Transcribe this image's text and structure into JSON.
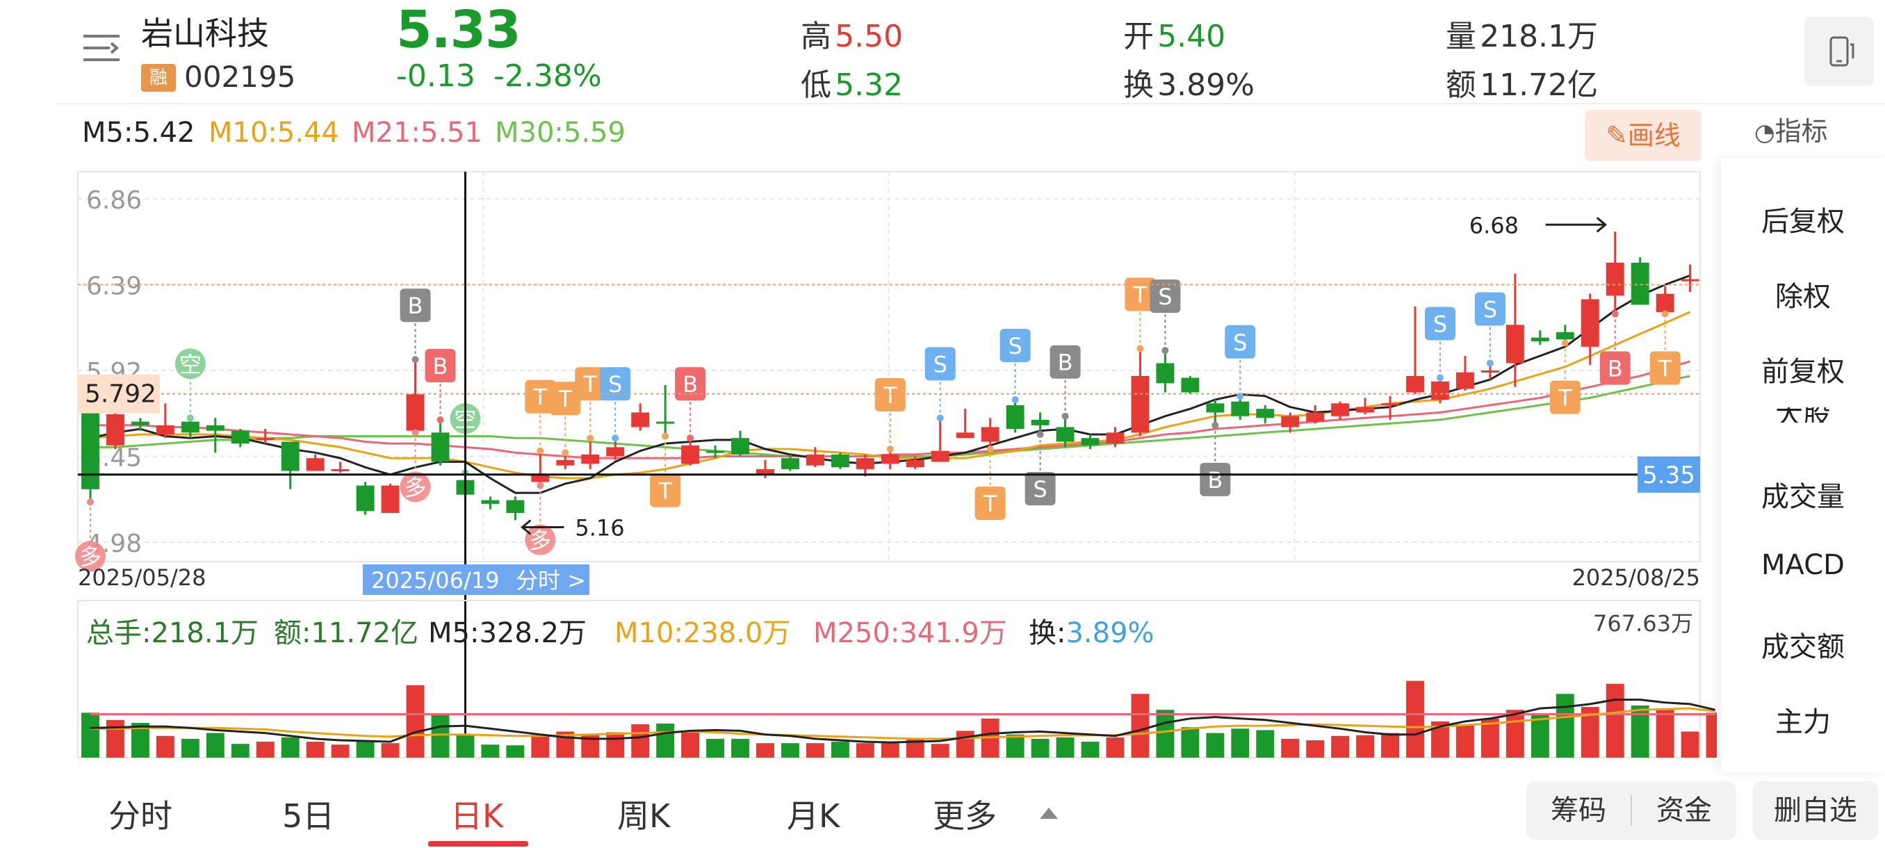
{
  "header": {
    "name": "岩山科技",
    "badge": "融",
    "code": "002195",
    "price": "5.33",
    "change": "-0.13",
    "change_pct": "-2.38%",
    "high_label": "高",
    "high": "5.50",
    "low_label": "低",
    "low": "5.32",
    "open_label": "开",
    "open": "5.40",
    "turnover_label": "换",
    "turnover": "3.89%",
    "volume_label": "量",
    "volume": "218.1万",
    "amount_label": "额",
    "amount": "11.72亿"
  },
  "ma": {
    "m5": "M5:5.42",
    "m10": "M10:5.44",
    "m21": "M21:5.51",
    "m30": "M30:5.59",
    "colors": {
      "m5": "#222222",
      "m10": "#e8a317",
      "m21": "#e86877",
      "m30": "#6cc24a"
    }
  },
  "draw_button": "画线",
  "indicator_button": "指标",
  "right_panel": {
    "items": [
      "后复权",
      "除权",
      "前复权",
      "成交量",
      "MACD",
      "成交额",
      "主力"
    ],
    "partial": "大股"
  },
  "chart_data": {
    "type": "candlestick",
    "y_ticks": [
      "6.86",
      "6.39",
      "5.92",
      "5.45",
      "4.98"
    ],
    "ylim": [
      4.98,
      6.86
    ],
    "crosshair_value": "5.792",
    "current_price_tag": "5.35",
    "start_date": "2025/05/28",
    "cursor_date": "2025/06/19",
    "cursor_link": "分时 >",
    "end_date": "2025/08/25",
    "max_label": "6.68",
    "min_label": "5.16",
    "candles": [
      {
        "o": 5.69,
        "c": 5.27,
        "h": 5.74,
        "l": 5.2
      },
      {
        "o": 5.51,
        "c": 5.68,
        "h": 5.72,
        "l": 5.49
      },
      {
        "o": 5.64,
        "c": 5.62,
        "h": 5.66,
        "l": 5.59
      },
      {
        "o": 5.57,
        "c": 5.62,
        "h": 5.74,
        "l": 5.55
      },
      {
        "o": 5.64,
        "c": 5.58,
        "h": 5.66,
        "l": 5.55
      },
      {
        "o": 5.62,
        "c": 5.59,
        "h": 5.66,
        "l": 5.47
      },
      {
        "o": 5.59,
        "c": 5.52,
        "h": 5.6,
        "l": 5.5
      },
      {
        "o": 5.55,
        "c": 5.55,
        "h": 5.6,
        "l": 5.52
      },
      {
        "o": 5.53,
        "c": 5.37,
        "h": 5.53,
        "l": 5.27
      },
      {
        "o": 5.37,
        "c": 5.44,
        "h": 5.46,
        "l": 5.37
      },
      {
        "o": 5.38,
        "c": 5.38,
        "h": 5.42,
        "l": 5.36
      },
      {
        "o": 5.29,
        "c": 5.15,
        "h": 5.31,
        "l": 5.13
      },
      {
        "o": 5.14,
        "c": 5.29,
        "h": 5.3,
        "l": 5.14
      },
      {
        "o": 5.59,
        "c": 5.79,
        "h": 5.98,
        "l": 5.58
      },
      {
        "o": 5.58,
        "c": 5.42,
        "h": 5.65,
        "l": 5.4
      },
      {
        "o": 5.32,
        "c": 5.24,
        "h": 5.36,
        "l": 5.18
      },
      {
        "o": 5.21,
        "c": 5.19,
        "h": 5.23,
        "l": 5.16
      },
      {
        "o": 5.21,
        "c": 5.14,
        "h": 5.23,
        "l": 5.1
      },
      {
        "o": 5.31,
        "c": 5.35,
        "h": 5.48,
        "l": 5.29
      },
      {
        "o": 5.4,
        "c": 5.43,
        "h": 5.47,
        "l": 5.38
      },
      {
        "o": 5.41,
        "c": 5.46,
        "h": 5.55,
        "l": 5.38
      },
      {
        "o": 5.45,
        "c": 5.5,
        "h": 5.55,
        "l": 5.43
      },
      {
        "o": 5.61,
        "c": 5.69,
        "h": 5.74,
        "l": 5.59
      },
      {
        "o": 5.64,
        "c": 5.63,
        "h": 5.84,
        "l": 5.56
      },
      {
        "o": 5.41,
        "c": 5.51,
        "h": 5.55,
        "l": 5.4
      },
      {
        "o": 5.48,
        "c": 5.47,
        "h": 5.51,
        "l": 5.44
      },
      {
        "o": 5.55,
        "c": 5.46,
        "h": 5.59,
        "l": 5.45
      },
      {
        "o": 5.35,
        "c": 5.38,
        "h": 5.43,
        "l": 5.33
      },
      {
        "o": 5.44,
        "c": 5.38,
        "h": 5.46,
        "l": 5.37
      },
      {
        "o": 5.4,
        "c": 5.46,
        "h": 5.5,
        "l": 5.39
      },
      {
        "o": 5.46,
        "c": 5.39,
        "h": 5.47,
        "l": 5.38
      },
      {
        "o": 5.38,
        "c": 5.44,
        "h": 5.46,
        "l": 5.34
      },
      {
        "o": 5.41,
        "c": 5.46,
        "h": 5.49,
        "l": 5.38
      },
      {
        "o": 5.39,
        "c": 5.43,
        "h": 5.45,
        "l": 5.38
      },
      {
        "o": 5.42,
        "c": 5.48,
        "h": 5.66,
        "l": 5.42
      },
      {
        "o": 5.55,
        "c": 5.58,
        "h": 5.71,
        "l": 5.55
      },
      {
        "o": 5.53,
        "c": 5.61,
        "h": 5.66,
        "l": 5.49
      },
      {
        "o": 5.73,
        "c": 5.6,
        "h": 5.76,
        "l": 5.58
      },
      {
        "o": 5.65,
        "c": 5.62,
        "h": 5.69,
        "l": 5.57
      },
      {
        "o": 5.61,
        "c": 5.53,
        "h": 5.67,
        "l": 5.5
      },
      {
        "o": 5.55,
        "c": 5.51,
        "h": 5.57,
        "l": 5.49
      },
      {
        "o": 5.52,
        "c": 5.58,
        "h": 5.61,
        "l": 5.5
      },
      {
        "o": 5.58,
        "c": 5.89,
        "h": 6.04,
        "l": 5.56
      },
      {
        "o": 5.96,
        "c": 5.85,
        "h": 6.03,
        "l": 5.8
      },
      {
        "o": 5.88,
        "c": 5.8,
        "h": 5.89,
        "l": 5.79
      },
      {
        "o": 5.74,
        "c": 5.69,
        "h": 5.76,
        "l": 5.62
      },
      {
        "o": 5.75,
        "c": 5.67,
        "h": 5.78,
        "l": 5.65
      },
      {
        "o": 5.71,
        "c": 5.66,
        "h": 5.73,
        "l": 5.63
      },
      {
        "o": 5.61,
        "c": 5.67,
        "h": 5.69,
        "l": 5.58
      },
      {
        "o": 5.64,
        "c": 5.69,
        "h": 5.73,
        "l": 5.63
      },
      {
        "o": 5.67,
        "c": 5.74,
        "h": 5.75,
        "l": 5.65
      },
      {
        "o": 5.69,
        "c": 5.72,
        "h": 5.77,
        "l": 5.68
      },
      {
        "o": 5.74,
        "c": 5.74,
        "h": 5.78,
        "l": 5.65
      },
      {
        "o": 5.8,
        "c": 5.89,
        "h": 6.27,
        "l": 5.79
      },
      {
        "o": 5.76,
        "c": 5.86,
        "h": 5.88,
        "l": 5.74
      },
      {
        "o": 5.82,
        "c": 5.91,
        "h": 6.0,
        "l": 5.81
      },
      {
        "o": 5.92,
        "c": 5.92,
        "h": 5.96,
        "l": 5.87
      },
      {
        "o": 5.96,
        "c": 6.17,
        "h": 6.45,
        "l": 5.83
      },
      {
        "o": 6.1,
        "c": 6.08,
        "h": 6.14,
        "l": 6.06
      },
      {
        "o": 6.13,
        "c": 6.09,
        "h": 6.17,
        "l": 6.07
      },
      {
        "o": 6.05,
        "c": 6.31,
        "h": 6.34,
        "l": 5.95
      },
      {
        "o": 6.33,
        "c": 6.51,
        "h": 6.68,
        "l": 6.23
      },
      {
        "o": 6.51,
        "c": 6.28,
        "h": 6.54,
        "l": 6.28
      },
      {
        "o": 6.24,
        "c": 6.34,
        "h": 6.38,
        "l": 6.23
      },
      {
        "o": 6.41,
        "c": 6.42,
        "h": 6.5,
        "l": 6.35
      }
    ],
    "ma5": [
      5.55,
      5.58,
      5.6,
      5.56,
      5.55,
      5.56,
      5.55,
      5.52,
      5.49,
      5.47,
      5.44,
      5.39,
      5.35,
      5.39,
      5.42,
      5.42,
      5.33,
      5.25,
      5.25,
      5.3,
      5.33,
      5.42,
      5.48,
      5.52,
      5.53,
      5.54,
      5.54,
      5.49,
      5.46,
      5.44,
      5.42,
      5.41,
      5.42,
      5.43,
      5.45,
      5.47,
      5.51,
      5.55,
      5.59,
      5.6,
      5.57,
      5.57,
      5.62,
      5.67,
      5.71,
      5.76,
      5.79,
      5.78,
      5.72,
      5.69,
      5.7,
      5.71,
      5.72,
      5.76,
      5.79,
      5.83,
      5.87,
      5.95,
      6.0,
      6.05,
      6.15,
      6.25,
      6.33,
      6.39,
      6.44
    ],
    "ma10": [
      5.55,
      5.56,
      5.57,
      5.57,
      5.57,
      5.57,
      5.56,
      5.55,
      5.54,
      5.52,
      5.5,
      5.47,
      5.44,
      5.44,
      5.44,
      5.42,
      5.39,
      5.36,
      5.34,
      5.33,
      5.33,
      5.35,
      5.36,
      5.38,
      5.41,
      5.44,
      5.48,
      5.49,
      5.49,
      5.48,
      5.47,
      5.46,
      5.44,
      5.44,
      5.44,
      5.44,
      5.46,
      5.48,
      5.51,
      5.52,
      5.53,
      5.54,
      5.57,
      5.61,
      5.64,
      5.67,
      5.68,
      5.68,
      5.67,
      5.68,
      5.7,
      5.72,
      5.74,
      5.75,
      5.76,
      5.79,
      5.82,
      5.86,
      5.9,
      5.94,
      6.0,
      6.06,
      6.12,
      6.18,
      6.24
    ],
    "ma21": [
      5.62,
      5.62,
      5.62,
      5.61,
      5.61,
      5.6,
      5.59,
      5.58,
      5.57,
      5.56,
      5.55,
      5.53,
      5.52,
      5.52,
      5.51,
      5.5,
      5.49,
      5.47,
      5.46,
      5.45,
      5.44,
      5.44,
      5.44,
      5.44,
      5.44,
      5.45,
      5.45,
      5.45,
      5.45,
      5.45,
      5.45,
      5.45,
      5.46,
      5.46,
      5.47,
      5.47,
      5.48,
      5.49,
      5.5,
      5.51,
      5.52,
      5.53,
      5.55,
      5.57,
      5.58,
      5.6,
      5.61,
      5.62,
      5.63,
      5.64,
      5.65,
      5.66,
      5.67,
      5.68,
      5.69,
      5.71,
      5.73,
      5.75,
      5.77,
      5.8,
      5.83,
      5.86,
      5.89,
      5.93,
      5.97
    ],
    "ma30": [
      5.5,
      5.5,
      5.51,
      5.52,
      5.53,
      5.54,
      5.54,
      5.55,
      5.55,
      5.56,
      5.56,
      5.56,
      5.56,
      5.56,
      5.56,
      5.56,
      5.56,
      5.55,
      5.55,
      5.54,
      5.53,
      5.52,
      5.51,
      5.5,
      5.49,
      5.48,
      5.47,
      5.46,
      5.45,
      5.45,
      5.45,
      5.45,
      5.45,
      5.45,
      5.45,
      5.46,
      5.47,
      5.48,
      5.49,
      5.5,
      5.51,
      5.52,
      5.53,
      5.54,
      5.55,
      5.56,
      5.57,
      5.58,
      5.59,
      5.6,
      5.61,
      5.62,
      5.63,
      5.64,
      5.65,
      5.67,
      5.69,
      5.71,
      5.73,
      5.75,
      5.77,
      5.8,
      5.83,
      5.86,
      5.89
    ],
    "markers": [
      {
        "i": 0,
        "t": "多",
        "c": "#f28a8a",
        "ty": "circle",
        "pos": "low"
      },
      {
        "i": 4,
        "t": "空",
        "c": "#7fcf8f",
        "ty": "circle",
        "pos": "high"
      },
      {
        "i": 13,
        "t": "B",
        "c": "#8a8a8a",
        "ty": "tag",
        "pos": "high"
      },
      {
        "i": 13,
        "t": "多",
        "c": "#f28a8a",
        "ty": "circle",
        "pos": "low"
      },
      {
        "i": 14,
        "t": "B",
        "c": "#ef6a6a",
        "ty": "tag",
        "pos": "high"
      },
      {
        "i": 15,
        "t": "空",
        "c": "#7fcf8f",
        "ty": "circle",
        "pos": "high"
      },
      {
        "i": 18,
        "t": "多",
        "c": "#f28a8a",
        "ty": "circle",
        "pos": "low"
      },
      {
        "i": 18,
        "t": "T",
        "c": "#f4a358",
        "ty": "tag",
        "pos": "high"
      },
      {
        "i": 19,
        "t": "T",
        "c": "#f4a358",
        "ty": "tag",
        "pos": "high"
      },
      {
        "i": 20,
        "t": "T",
        "c": "#f4a358",
        "ty": "tag",
        "pos": "high"
      },
      {
        "i": 21,
        "t": "S",
        "c": "#6fb0ee",
        "ty": "tag",
        "pos": "high"
      },
      {
        "i": 23,
        "t": "T",
        "c": "#f4a358",
        "ty": "tag",
        "pos": "low"
      },
      {
        "i": 24,
        "t": "B",
        "c": "#ef6a6a",
        "ty": "tag",
        "pos": "high"
      },
      {
        "i": 32,
        "t": "T",
        "c": "#f4a358",
        "ty": "tag",
        "pos": "high"
      },
      {
        "i": 34,
        "t": "S",
        "c": "#6fb0ee",
        "ty": "tag",
        "pos": "high"
      },
      {
        "i": 36,
        "t": "T",
        "c": "#f4a358",
        "ty": "tag",
        "pos": "low"
      },
      {
        "i": 37,
        "t": "S",
        "c": "#6fb0ee",
        "ty": "tag",
        "pos": "high"
      },
      {
        "i": 38,
        "t": "S",
        "c": "#8a8a8a",
        "ty": "tag",
        "pos": "low"
      },
      {
        "i": 39,
        "t": "B",
        "c": "#8a8a8a",
        "ty": "tag",
        "pos": "high"
      },
      {
        "i": 42,
        "t": "T",
        "c": "#f4a358",
        "ty": "tag",
        "pos": "high"
      },
      {
        "i": 43,
        "t": "S",
        "c": "#8a8a8a",
        "ty": "tag",
        "pos": "high"
      },
      {
        "i": 45,
        "t": "B",
        "c": "#8a8a8a",
        "ty": "tag",
        "pos": "low"
      },
      {
        "i": 46,
        "t": "S",
        "c": "#6fb0ee",
        "ty": "tag",
        "pos": "high"
      },
      {
        "i": 54,
        "t": "S",
        "c": "#6fb0ee",
        "ty": "tag",
        "pos": "high"
      },
      {
        "i": 56,
        "t": "S",
        "c": "#6fb0ee",
        "ty": "tag",
        "pos": "high"
      },
      {
        "i": 59,
        "t": "T",
        "c": "#f4a358",
        "ty": "tag",
        "pos": "low"
      },
      {
        "i": 61,
        "t": "B",
        "c": "#ef6a6a",
        "ty": "tag",
        "pos": "low"
      },
      {
        "i": 63,
        "t": "T",
        "c": "#f4a358",
        "ty": "tag",
        "pos": "low"
      }
    ],
    "volume_panel": {
      "total_label": "总手:218.1万",
      "amount_label": "额:11.72亿",
      "m5_label": "M5:328.2万",
      "m10_label": "M10:238.0万",
      "m250_label": "M250:341.9万",
      "turnover_label": "换:",
      "turnover_value": "3.89%",
      "max_label": "767.63万",
      "ymax": 767.63,
      "values": [
        310,
        260,
        240,
        150,
        130,
        170,
        95,
        110,
        140,
        110,
        90,
        120,
        100,
        500,
        300,
        160,
        90,
        85,
        160,
        180,
        165,
        175,
        230,
        235,
        180,
        130,
        130,
        100,
        100,
        100,
        110,
        100,
        100,
        130,
        95,
        185,
        270,
        160,
        130,
        140,
        110,
        140,
        440,
        330,
        210,
        170,
        200,
        190,
        130,
        120,
        150,
        155,
        170,
        530,
        250,
        230,
        270,
        330,
        300,
        440,
        350,
        510,
        360,
        340,
        180,
        310
      ],
      "ma5": [
        205,
        208,
        215,
        215,
        205,
        190,
        180,
        170,
        150,
        130,
        120,
        115,
        110,
        175,
        215,
        220,
        200,
        180,
        160,
        140,
        130,
        130,
        140,
        170,
        185,
        190,
        185,
        160,
        150,
        130,
        120,
        110,
        105,
        110,
        115,
        140,
        165,
        175,
        180,
        170,
        160,
        150,
        190,
        240,
        270,
        280,
        270,
        260,
        240,
        220,
        200,
        175,
        160,
        160,
        215,
        250,
        270,
        300,
        340,
        350,
        370,
        400,
        400,
        380,
        370,
        330
      ],
      "ma10": [
        200,
        200,
        205,
        205,
        205,
        205,
        200,
        195,
        180,
        170,
        160,
        150,
        145,
        155,
        160,
        160,
        155,
        150,
        150,
        155,
        160,
        165,
        170,
        175,
        180,
        175,
        165,
        160,
        155,
        150,
        145,
        140,
        135,
        130,
        130,
        135,
        140,
        145,
        150,
        155,
        155,
        155,
        165,
        180,
        200,
        215,
        220,
        220,
        225,
        230,
        225,
        220,
        215,
        210,
        215,
        225,
        235,
        250,
        265,
        280,
        295,
        310,
        330,
        335,
        340,
        320
      ],
      "ma250": [
        300,
        300,
        300,
        300,
        300,
        300,
        300,
        300,
        300,
        300,
        300,
        300,
        300,
        300,
        300,
        300,
        300,
        300,
        300,
        300,
        300,
        300,
        300,
        300,
        300,
        300,
        300,
        300,
        300,
        300,
        300,
        300,
        300,
        300,
        300,
        300,
        300,
        300,
        300,
        300,
        300,
        300,
        300,
        300,
        300,
        300,
        300,
        300,
        300,
        300,
        300,
        300,
        300,
        300,
        300,
        300,
        300,
        300,
        300,
        300,
        300,
        300,
        300,
        300,
        300,
        300
      ]
    },
    "colors": {
      "up": "#e53935",
      "down": "#1a9a2a",
      "grid": "#e6e6e6",
      "cursor_box": "#6fa8ef",
      "last_price": "#5aa2f0"
    }
  },
  "tabs": {
    "items": [
      "分时",
      "5日",
      "日K",
      "周K",
      "月K",
      "更多"
    ],
    "active": "日K"
  },
  "bottom_buttons": {
    "chips": "筹码",
    "funds": "资金",
    "remove": "删自选"
  }
}
